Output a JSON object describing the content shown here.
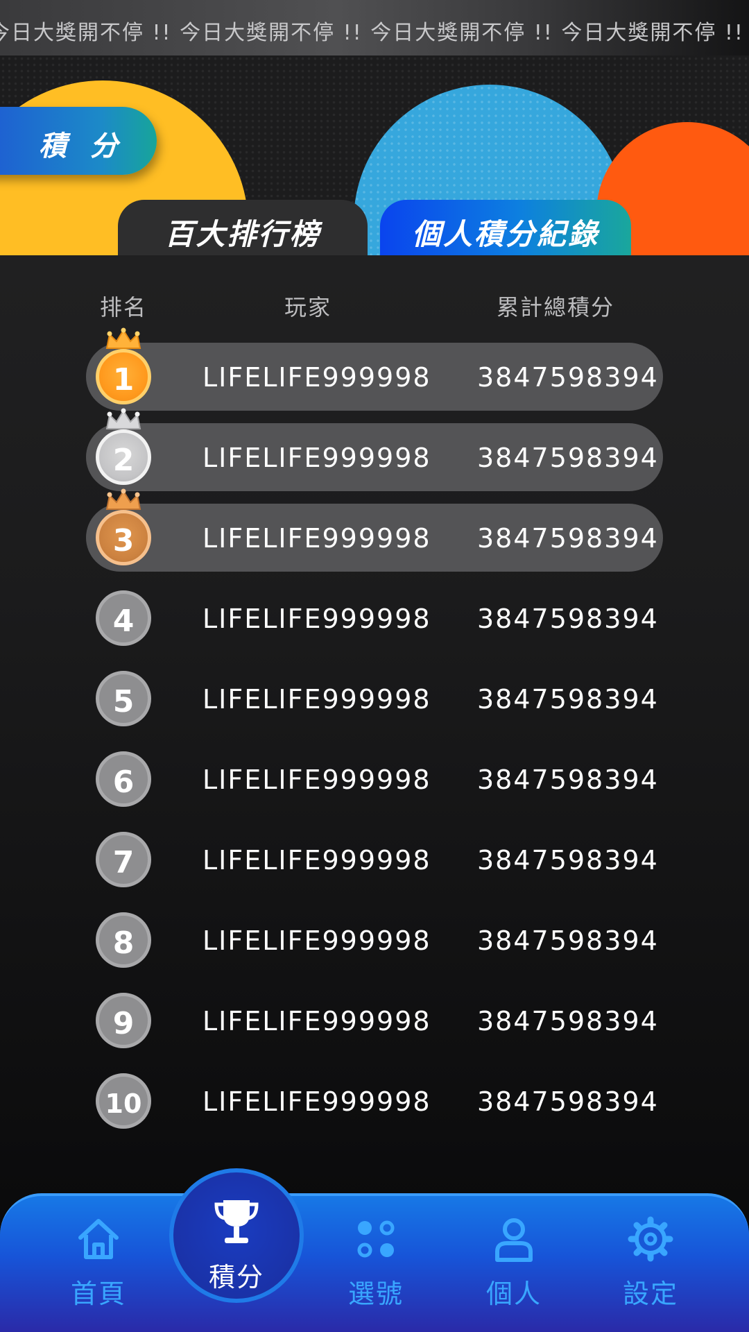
{
  "marquee": {
    "text": "今日大獎開不停 !! 今日大獎開不停 !! 今日大獎開不停 !! 今日大獎開不停 !! 今"
  },
  "header": {
    "page_badge": "積 分",
    "tabs": [
      {
        "label": "百大排行榜",
        "active": true
      },
      {
        "label": "個人積分紀錄",
        "active": false
      }
    ]
  },
  "table": {
    "columns": [
      "排名",
      "玩家",
      "累計總積分"
    ],
    "rows": [
      {
        "rank": "1",
        "player": "LIFELIFE999998",
        "score": "3847598394",
        "medal": "gold"
      },
      {
        "rank": "2",
        "player": "LIFELIFE999998",
        "score": "3847598394",
        "medal": "silver"
      },
      {
        "rank": "3",
        "player": "LIFELIFE999998",
        "score": "3847598394",
        "medal": "bronze"
      },
      {
        "rank": "4",
        "player": "LIFELIFE999998",
        "score": "3847598394",
        "medal": "plain"
      },
      {
        "rank": "5",
        "player": "LIFELIFE999998",
        "score": "3847598394",
        "medal": "plain"
      },
      {
        "rank": "6",
        "player": "LIFELIFE999998",
        "score": "3847598394",
        "medal": "plain"
      },
      {
        "rank": "7",
        "player": "LIFELIFE999998",
        "score": "3847598394",
        "medal": "plain"
      },
      {
        "rank": "8",
        "player": "LIFELIFE999998",
        "score": "3847598394",
        "medal": "plain"
      },
      {
        "rank": "9",
        "player": "LIFELIFE999998",
        "score": "3847598394",
        "medal": "plain"
      },
      {
        "rank": "10",
        "player": "LIFELIFE999998",
        "score": "3847598394",
        "medal": "plain"
      }
    ]
  },
  "nav": {
    "items": [
      {
        "label": "首頁",
        "icon": "home-icon"
      },
      {
        "label": "積分",
        "icon": "trophy-icon",
        "active": true
      },
      {
        "label": "選號",
        "icon": "grid-dots-icon"
      },
      {
        "label": "個人",
        "icon": "user-icon"
      },
      {
        "label": "設定",
        "icon": "gear-icon"
      }
    ]
  },
  "colors": {
    "yellow": "#ffbe24",
    "blue": "#36a7dd",
    "orange": "#ff5a10",
    "nav_blue": "#1778e6",
    "nav_label": "#39a6ff",
    "gold": "#ff9a1e",
    "silver": "#c4c4c6",
    "bronze": "#cc8240"
  }
}
